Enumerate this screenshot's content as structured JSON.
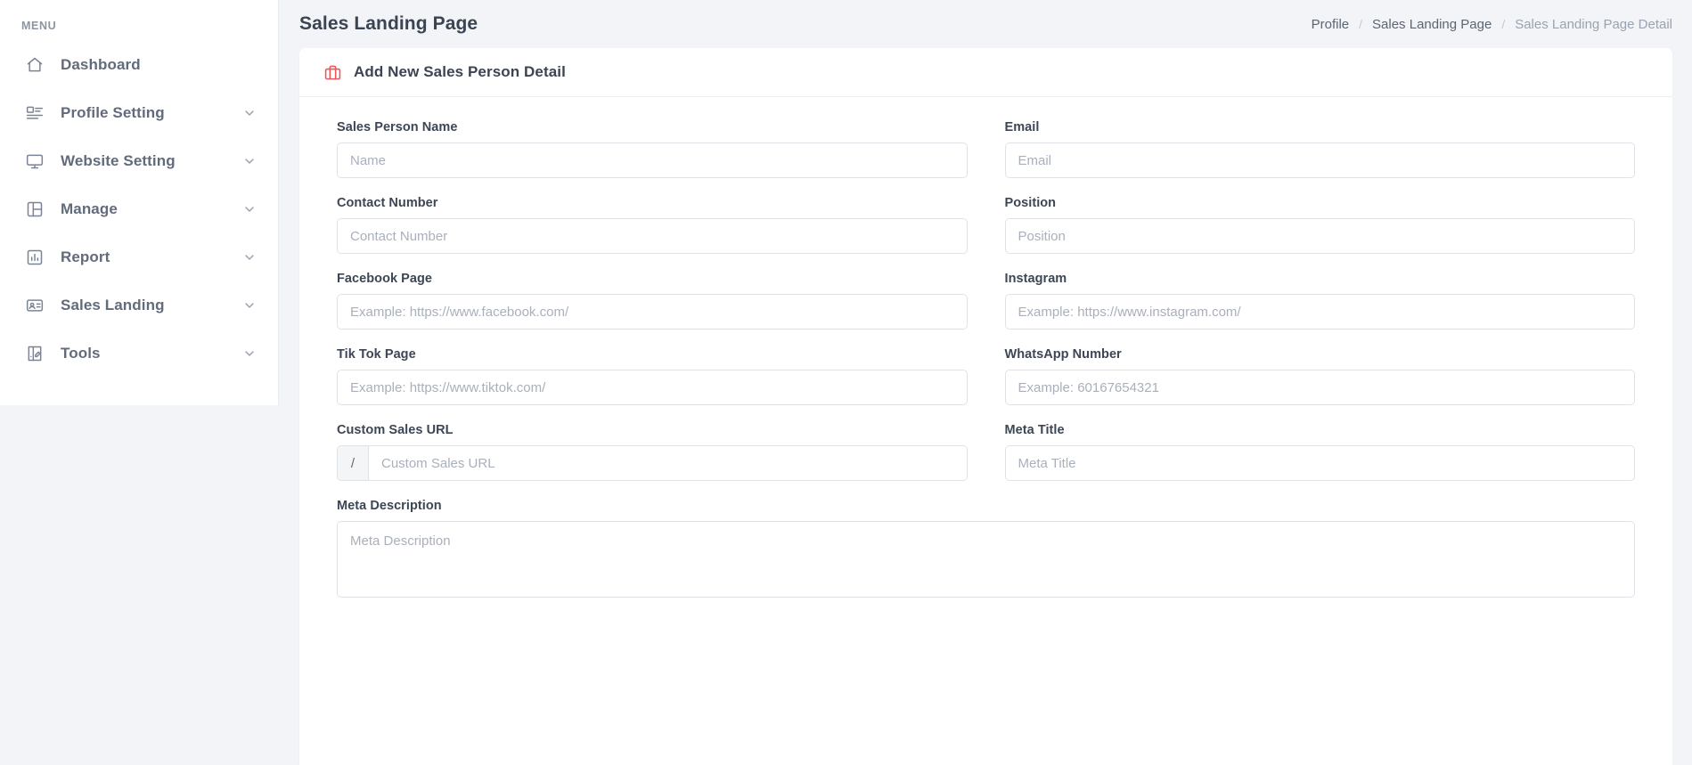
{
  "sidebar": {
    "heading": "MENU",
    "items": [
      {
        "label": "Dashboard",
        "icon": "home-icon",
        "has_caret": false
      },
      {
        "label": "Profile Setting",
        "icon": "profile-icon",
        "has_caret": true
      },
      {
        "label": "Website Setting",
        "icon": "monitor-icon",
        "has_caret": true
      },
      {
        "label": "Manage",
        "icon": "layout-icon",
        "has_caret": true
      },
      {
        "label": "Report",
        "icon": "bar-chart-icon",
        "has_caret": true
      },
      {
        "label": "Sales Landing",
        "icon": "id-card-icon",
        "has_caret": true
      },
      {
        "label": "Tools",
        "icon": "book-tools-icon",
        "has_caret": true
      }
    ]
  },
  "header": {
    "title": "Sales Landing Page",
    "breadcrumb": [
      {
        "label": "Profile",
        "current": false
      },
      {
        "label": "Sales Landing Page",
        "current": false
      },
      {
        "label": "Sales Landing Page Detail",
        "current": true
      }
    ],
    "separator": "/"
  },
  "card": {
    "icon": "briefcase-icon",
    "icon_color": "#e9595b",
    "title": "Add New Sales Person Detail"
  },
  "form": {
    "fields": [
      {
        "label": "Sales Person Name",
        "placeholder": "Name",
        "value": "",
        "type": "text",
        "column": "left",
        "prefix": null
      },
      {
        "label": "Email",
        "placeholder": "Email",
        "value": "",
        "type": "text",
        "column": "right",
        "prefix": null
      },
      {
        "label": "Contact Number",
        "placeholder": "Contact Number",
        "value": "",
        "type": "text",
        "column": "left",
        "prefix": null
      },
      {
        "label": "Position",
        "placeholder": "Position",
        "value": "",
        "type": "text",
        "column": "right",
        "prefix": null
      },
      {
        "label": "Facebook Page",
        "placeholder": "Example: https://www.facebook.com/",
        "value": "",
        "type": "text",
        "column": "left",
        "prefix": null
      },
      {
        "label": "Instagram",
        "placeholder": "Example: https://www.instagram.com/",
        "value": "",
        "type": "text",
        "column": "right",
        "prefix": null
      },
      {
        "label": "Tik Tok Page",
        "placeholder": "Example: https://www.tiktok.com/",
        "value": "",
        "type": "text",
        "column": "left",
        "prefix": null
      },
      {
        "label": "WhatsApp Number",
        "placeholder": "Example: 60167654321",
        "value": "",
        "type": "text",
        "column": "right",
        "prefix": null
      },
      {
        "label": "Custom Sales URL",
        "placeholder": "Custom Sales URL",
        "value": "",
        "type": "text",
        "column": "left",
        "prefix": "/"
      },
      {
        "label": "Meta Title",
        "placeholder": "Meta Title",
        "value": "",
        "type": "text",
        "column": "right",
        "prefix": null
      },
      {
        "label": "Meta Description",
        "placeholder": "Meta Description",
        "value": "",
        "type": "textarea",
        "column": "full",
        "prefix": null
      }
    ]
  },
  "colors": {
    "page_background": "#f2f4f7",
    "surface": "#ffffff",
    "accent": "#e9595b",
    "text_primary": "#3b4453",
    "text_muted": "#9aa3b1",
    "border": "#dfe3e8"
  }
}
